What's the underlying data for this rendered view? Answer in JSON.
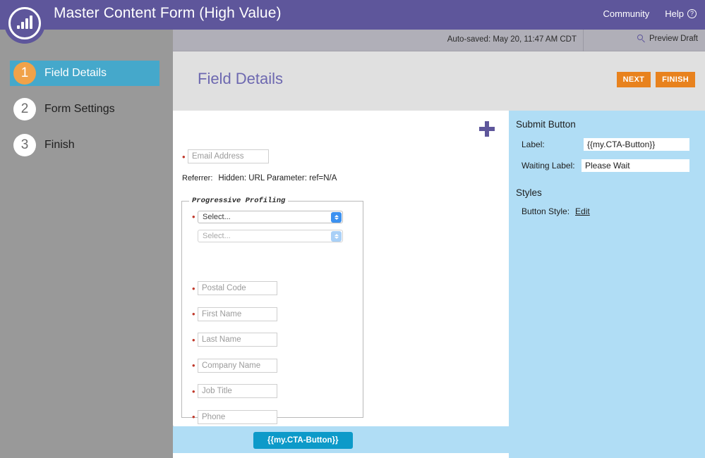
{
  "header": {
    "logo_icon": "marketo-bars-logo",
    "title": "Master Content Form (High Value)",
    "community_label": "Community",
    "help_label": "Help",
    "help_icon": "question-circle-icon",
    "brand_color": "#5e569b"
  },
  "toolbar": {
    "autosave_text": "Auto-saved: May 20, 11:47 AM CDT",
    "preview_label": "Preview Draft",
    "preview_icon": "magnifier-icon"
  },
  "sidebar": {
    "steps": [
      {
        "number": "1",
        "label": "Field Details",
        "active": true
      },
      {
        "number": "2",
        "label": "Form Settings",
        "active": false
      },
      {
        "number": "3",
        "label": "Finish",
        "active": false
      }
    ],
    "active_color": "#45a8cb",
    "active_badge_color": "#f0a249"
  },
  "content_header": {
    "title": "Field Details",
    "next_label": "NEXT",
    "finish_label": "FINISH",
    "button_color": "#e8821e"
  },
  "canvas": {
    "add_field_icon": "plus-icon",
    "required_marker": "•",
    "email_field": {
      "placeholder": "Email Address",
      "required": true
    },
    "referrer": {
      "label": "Referrer:",
      "value": "Hidden: URL Parameter: ref=N/A"
    },
    "fieldset": {
      "legend": "Progressive Profiling",
      "selects": [
        {
          "value": "Select...",
          "required": true,
          "disabled": false
        },
        {
          "value": "Select...",
          "required": false,
          "disabled": true
        }
      ],
      "fields": [
        {
          "placeholder": "Postal Code",
          "required": true
        },
        {
          "placeholder": "First Name",
          "required": true
        },
        {
          "placeholder": "Last Name",
          "required": true
        },
        {
          "placeholder": "Company Name",
          "required": true
        },
        {
          "placeholder": "Job Title",
          "required": true
        },
        {
          "placeholder": "Phone",
          "required": true
        }
      ]
    },
    "submit_button_label": "{{my.CTA-Button}}",
    "submit_button_color": "#0d9ac9",
    "strip_color": "#b0ddf5"
  },
  "settings_panel": {
    "section_submit": "Submit Button",
    "label_field_label": "Label:",
    "label_field_value": "{{my.CTA-Button}}",
    "waiting_field_label": "Waiting Label:",
    "waiting_field_value": "Please Wait",
    "section_styles": "Styles",
    "button_style_label": "Button Style:",
    "button_style_link": "Edit",
    "panel_color": "#b0ddf5"
  }
}
